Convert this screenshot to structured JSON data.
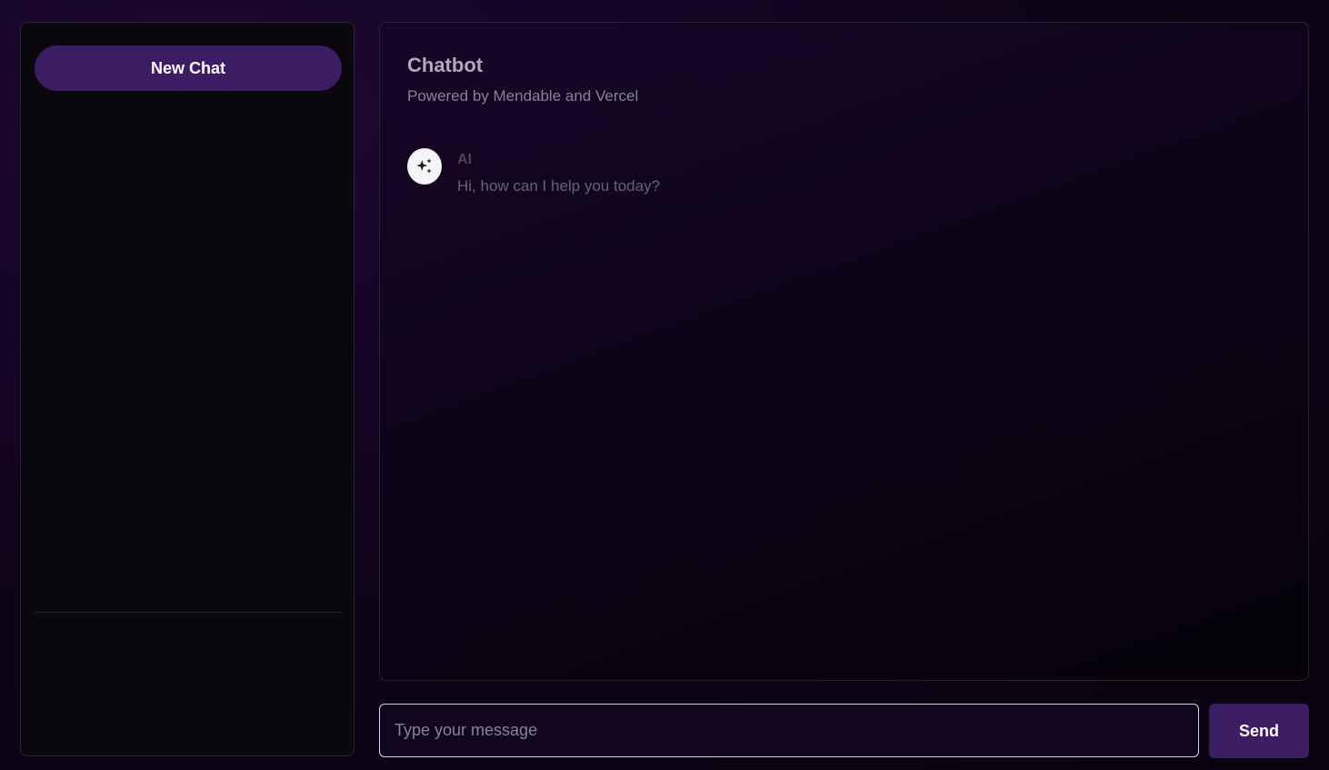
{
  "sidebar": {
    "new_chat_label": "New Chat"
  },
  "header": {
    "title": "Chatbot",
    "subtitle": "Powered by Mendable and Vercel"
  },
  "messages": [
    {
      "sender": "AI",
      "avatar_icon": "sparkles-icon",
      "text": "Hi, how can I help you today?"
    }
  ],
  "composer": {
    "placeholder": "Type your message",
    "value": "",
    "send_label": "Send"
  },
  "colors": {
    "accent": "#3c1c62",
    "background": "#0e0418",
    "panel_border": "#2a2233",
    "title": "#b3a6c9",
    "subtitle": "#8a7fa0"
  }
}
